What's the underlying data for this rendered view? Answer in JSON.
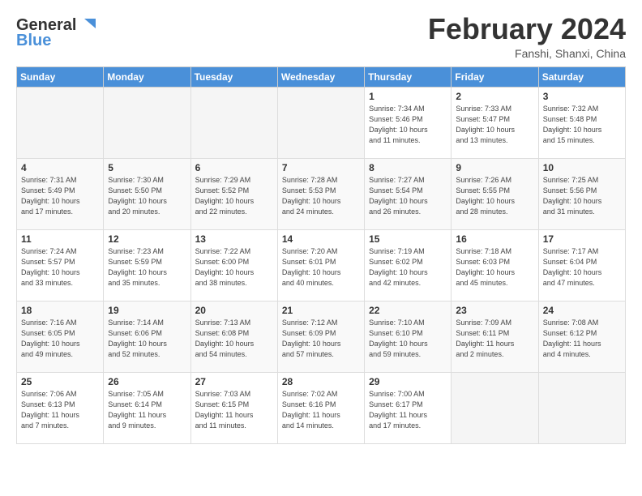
{
  "header": {
    "logo_line1": "General",
    "logo_line2": "Blue",
    "month_title": "February 2024",
    "location": "Fanshi, Shanxi, China"
  },
  "weekdays": [
    "Sunday",
    "Monday",
    "Tuesday",
    "Wednesday",
    "Thursday",
    "Friday",
    "Saturday"
  ],
  "weeks": [
    [
      {
        "day": "",
        "info": ""
      },
      {
        "day": "",
        "info": ""
      },
      {
        "day": "",
        "info": ""
      },
      {
        "day": "",
        "info": ""
      },
      {
        "day": "1",
        "info": "Sunrise: 7:34 AM\nSunset: 5:46 PM\nDaylight: 10 hours\nand 11 minutes."
      },
      {
        "day": "2",
        "info": "Sunrise: 7:33 AM\nSunset: 5:47 PM\nDaylight: 10 hours\nand 13 minutes."
      },
      {
        "day": "3",
        "info": "Sunrise: 7:32 AM\nSunset: 5:48 PM\nDaylight: 10 hours\nand 15 minutes."
      }
    ],
    [
      {
        "day": "4",
        "info": "Sunrise: 7:31 AM\nSunset: 5:49 PM\nDaylight: 10 hours\nand 17 minutes."
      },
      {
        "day": "5",
        "info": "Sunrise: 7:30 AM\nSunset: 5:50 PM\nDaylight: 10 hours\nand 20 minutes."
      },
      {
        "day": "6",
        "info": "Sunrise: 7:29 AM\nSunset: 5:52 PM\nDaylight: 10 hours\nand 22 minutes."
      },
      {
        "day": "7",
        "info": "Sunrise: 7:28 AM\nSunset: 5:53 PM\nDaylight: 10 hours\nand 24 minutes."
      },
      {
        "day": "8",
        "info": "Sunrise: 7:27 AM\nSunset: 5:54 PM\nDaylight: 10 hours\nand 26 minutes."
      },
      {
        "day": "9",
        "info": "Sunrise: 7:26 AM\nSunset: 5:55 PM\nDaylight: 10 hours\nand 28 minutes."
      },
      {
        "day": "10",
        "info": "Sunrise: 7:25 AM\nSunset: 5:56 PM\nDaylight: 10 hours\nand 31 minutes."
      }
    ],
    [
      {
        "day": "11",
        "info": "Sunrise: 7:24 AM\nSunset: 5:57 PM\nDaylight: 10 hours\nand 33 minutes."
      },
      {
        "day": "12",
        "info": "Sunrise: 7:23 AM\nSunset: 5:59 PM\nDaylight: 10 hours\nand 35 minutes."
      },
      {
        "day": "13",
        "info": "Sunrise: 7:22 AM\nSunset: 6:00 PM\nDaylight: 10 hours\nand 38 minutes."
      },
      {
        "day": "14",
        "info": "Sunrise: 7:20 AM\nSunset: 6:01 PM\nDaylight: 10 hours\nand 40 minutes."
      },
      {
        "day": "15",
        "info": "Sunrise: 7:19 AM\nSunset: 6:02 PM\nDaylight: 10 hours\nand 42 minutes."
      },
      {
        "day": "16",
        "info": "Sunrise: 7:18 AM\nSunset: 6:03 PM\nDaylight: 10 hours\nand 45 minutes."
      },
      {
        "day": "17",
        "info": "Sunrise: 7:17 AM\nSunset: 6:04 PM\nDaylight: 10 hours\nand 47 minutes."
      }
    ],
    [
      {
        "day": "18",
        "info": "Sunrise: 7:16 AM\nSunset: 6:05 PM\nDaylight: 10 hours\nand 49 minutes."
      },
      {
        "day": "19",
        "info": "Sunrise: 7:14 AM\nSunset: 6:06 PM\nDaylight: 10 hours\nand 52 minutes."
      },
      {
        "day": "20",
        "info": "Sunrise: 7:13 AM\nSunset: 6:08 PM\nDaylight: 10 hours\nand 54 minutes."
      },
      {
        "day": "21",
        "info": "Sunrise: 7:12 AM\nSunset: 6:09 PM\nDaylight: 10 hours\nand 57 minutes."
      },
      {
        "day": "22",
        "info": "Sunrise: 7:10 AM\nSunset: 6:10 PM\nDaylight: 10 hours\nand 59 minutes."
      },
      {
        "day": "23",
        "info": "Sunrise: 7:09 AM\nSunset: 6:11 PM\nDaylight: 11 hours\nand 2 minutes."
      },
      {
        "day": "24",
        "info": "Sunrise: 7:08 AM\nSunset: 6:12 PM\nDaylight: 11 hours\nand 4 minutes."
      }
    ],
    [
      {
        "day": "25",
        "info": "Sunrise: 7:06 AM\nSunset: 6:13 PM\nDaylight: 11 hours\nand 7 minutes."
      },
      {
        "day": "26",
        "info": "Sunrise: 7:05 AM\nSunset: 6:14 PM\nDaylight: 11 hours\nand 9 minutes."
      },
      {
        "day": "27",
        "info": "Sunrise: 7:03 AM\nSunset: 6:15 PM\nDaylight: 11 hours\nand 11 minutes."
      },
      {
        "day": "28",
        "info": "Sunrise: 7:02 AM\nSunset: 6:16 PM\nDaylight: 11 hours\nand 14 minutes."
      },
      {
        "day": "29",
        "info": "Sunrise: 7:00 AM\nSunset: 6:17 PM\nDaylight: 11 hours\nand 17 minutes."
      },
      {
        "day": "",
        "info": ""
      },
      {
        "day": "",
        "info": ""
      }
    ]
  ]
}
